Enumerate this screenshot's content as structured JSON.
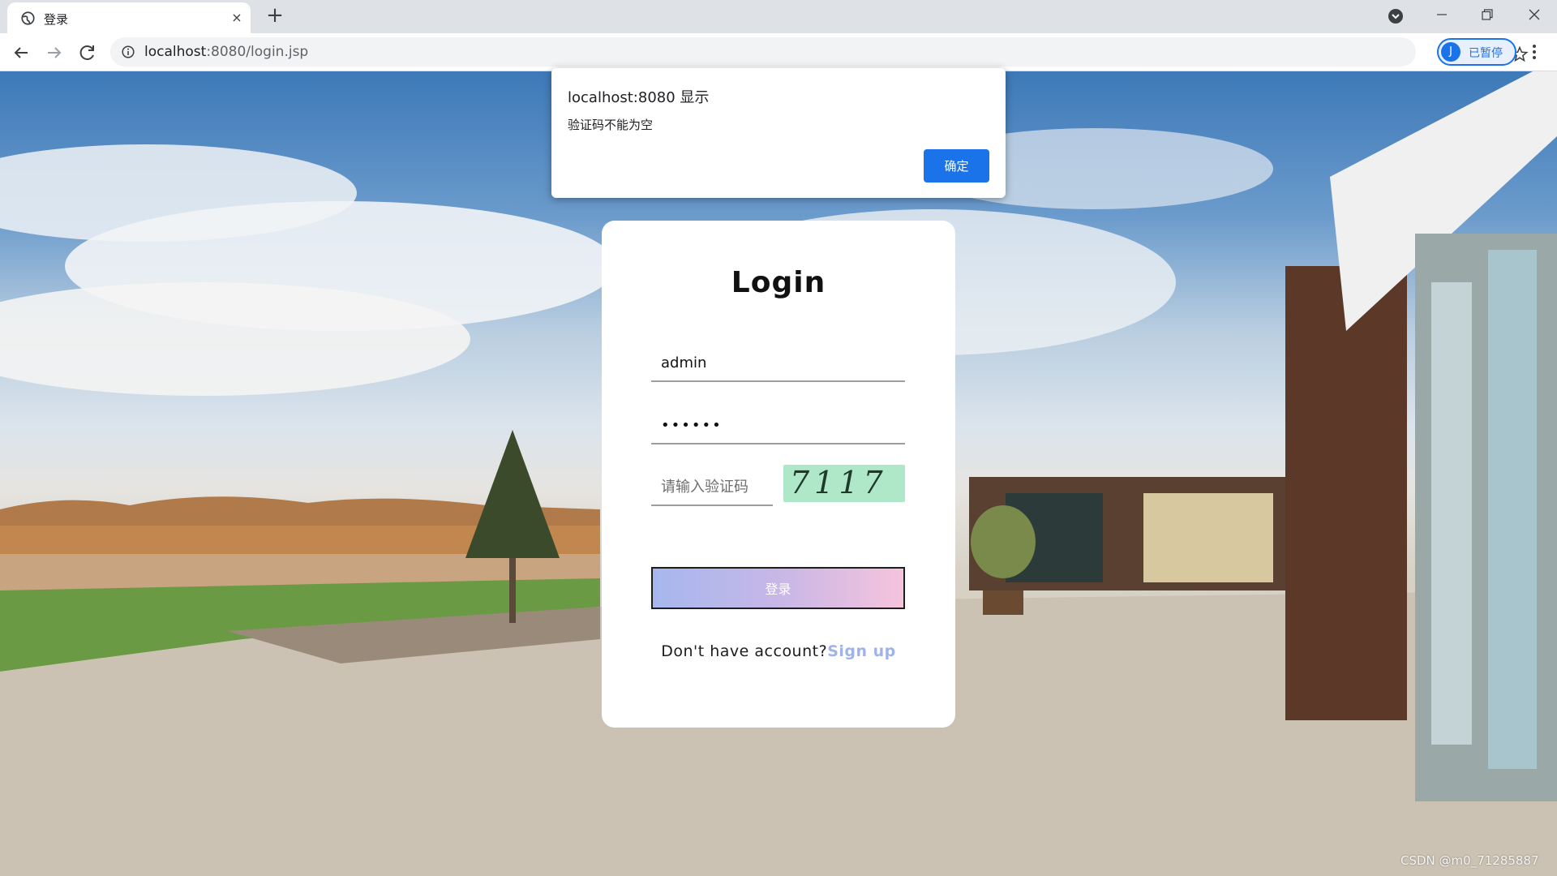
{
  "browser": {
    "tab_title": "登录",
    "tab_favicon": "globe-icon",
    "tab_close": "×",
    "new_tab": "+",
    "url_host": "localhost",
    "url_rest": ":8080/login.jsp",
    "profile_initial": "J",
    "profile_label": "已暂停",
    "icons": [
      "back-icon",
      "forward-icon",
      "reload-icon",
      "info-icon",
      "star-icon",
      "more-menu-icon",
      "tab-search-icon",
      "minimize-icon",
      "maximize-icon",
      "close-window-icon"
    ]
  },
  "alert": {
    "title": "localhost:8080 显示",
    "message": "验证码不能为空",
    "ok_label": "确定"
  },
  "login": {
    "title": "Login",
    "username_value": "admin",
    "password_value": "••••••",
    "captcha_placeholder": "请输入验证码",
    "captcha_text": "7117",
    "submit_label": "登录",
    "signup_prompt": "Don't have account?",
    "signup_link": "Sign up"
  },
  "watermark": {
    "credit": "CSDN @m0_71285887"
  },
  "colors": {
    "accent_blue": "#1a73e8",
    "captcha_bg": "#aee8c9",
    "button_gradient_start": "#a6b7ee",
    "button_gradient_end": "#f6c3dd",
    "signup_link": "#a0b3e8"
  }
}
